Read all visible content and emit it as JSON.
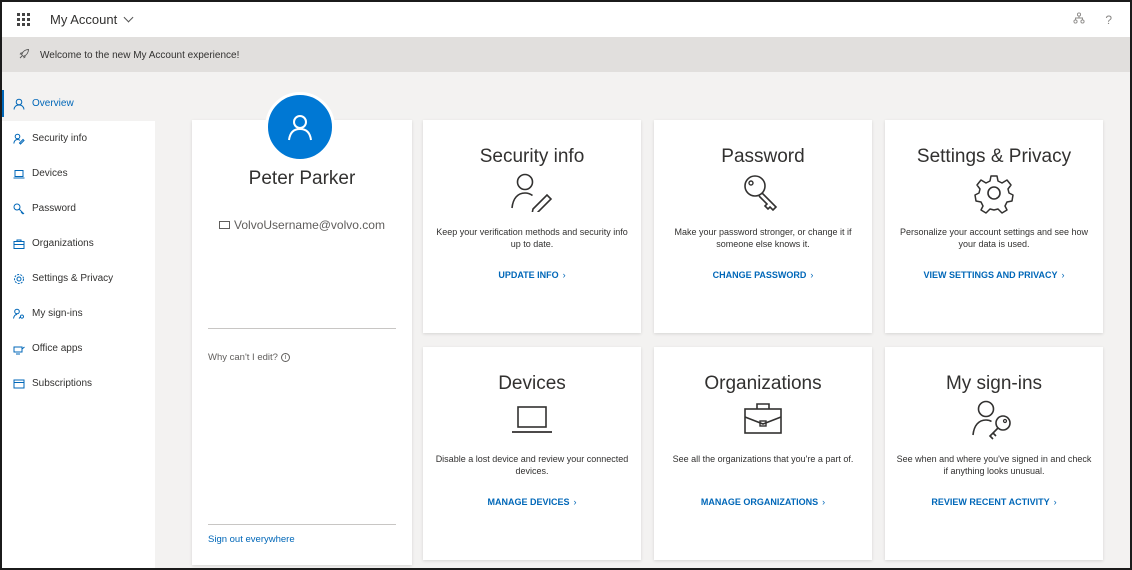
{
  "header": {
    "app_title": "My Account",
    "org_icon": "organization-icon",
    "help_icon": "?"
  },
  "banner": {
    "text": "Welcome to the new My Account experience!"
  },
  "sidebar": {
    "items": [
      {
        "label": "Overview",
        "icon": "person-icon",
        "active": true
      },
      {
        "label": "Security info",
        "icon": "security-info-icon"
      },
      {
        "label": "Devices",
        "icon": "laptop-icon"
      },
      {
        "label": "Password",
        "icon": "key-icon"
      },
      {
        "label": "Organizations",
        "icon": "briefcase-icon"
      },
      {
        "label": "Settings & Privacy",
        "icon": "gear-icon"
      },
      {
        "label": "My sign-ins",
        "icon": "sign-ins-icon"
      },
      {
        "label": "Office apps",
        "icon": "office-apps-icon"
      },
      {
        "label": "Subscriptions",
        "icon": "subscriptions-icon"
      }
    ]
  },
  "profile": {
    "name": "Peter Parker",
    "email": "VolvoUsername@volvo.com",
    "why_edit": "Why can't I edit?",
    "sign_out": "Sign out everywhere"
  },
  "tiles": {
    "security": {
      "title": "Security info",
      "desc": "Keep your verification methods and security info up to date.",
      "link": "UPDATE INFO"
    },
    "password": {
      "title": "Password",
      "desc": "Make your password stronger, or change it if someone else knows it.",
      "link": "CHANGE PASSWORD"
    },
    "settings": {
      "title": "Settings & Privacy",
      "desc": "Personalize your account settings and see how your data is used.",
      "link": "VIEW SETTINGS AND PRIVACY"
    },
    "devices": {
      "title": "Devices",
      "desc": "Disable a lost device and review your connected devices.",
      "link": "MANAGE DEVICES"
    },
    "organizations": {
      "title": "Organizations",
      "desc": "See all the organizations that you're a part of.",
      "link": "MANAGE ORGANIZATIONS"
    },
    "signins": {
      "title": "My sign-ins",
      "desc": "See when and where you've signed in and check if anything looks unusual.",
      "link": "REVIEW RECENT ACTIVITY"
    }
  },
  "colors": {
    "accent": "#0067b8",
    "avatar": "#0078d4",
    "background": "#f3f2f1",
    "banner": "#e1dfdd"
  }
}
